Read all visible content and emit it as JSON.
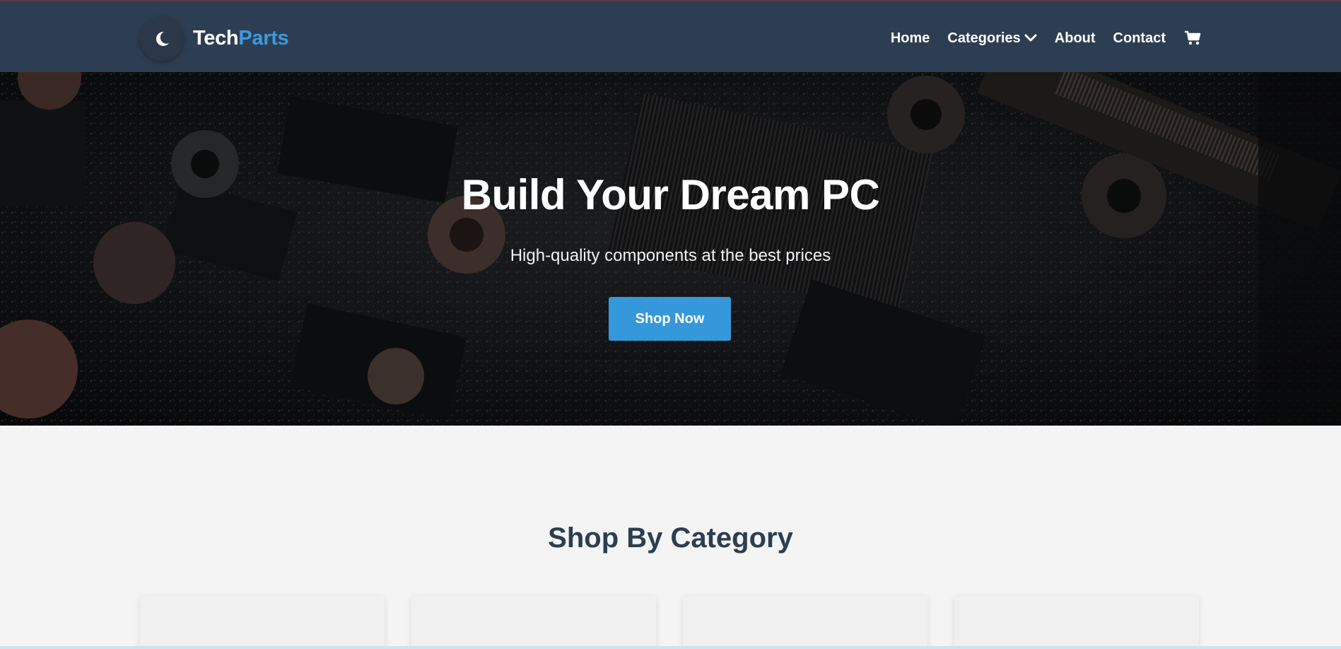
{
  "navbar": {
    "theme_icon": "moon-icon",
    "logo_main": "Tech",
    "logo_accent": "Parts",
    "links": [
      {
        "label": "Home"
      },
      {
        "label": "Categories",
        "icon": "chevron-down-icon"
      },
      {
        "label": "About"
      },
      {
        "label": "Contact"
      }
    ],
    "cart_icon": "cart-icon",
    "colors": {
      "background": "#2e3e52",
      "accent": "#3e9ae0"
    }
  },
  "hero": {
    "title": "Build Your Dream PC",
    "subtitle": "High-quality components at the best prices",
    "button_label": "Shop Now",
    "button_color": "#3498db"
  },
  "categories": {
    "title": "Shop By Category",
    "title_color": "#2c3e50"
  }
}
